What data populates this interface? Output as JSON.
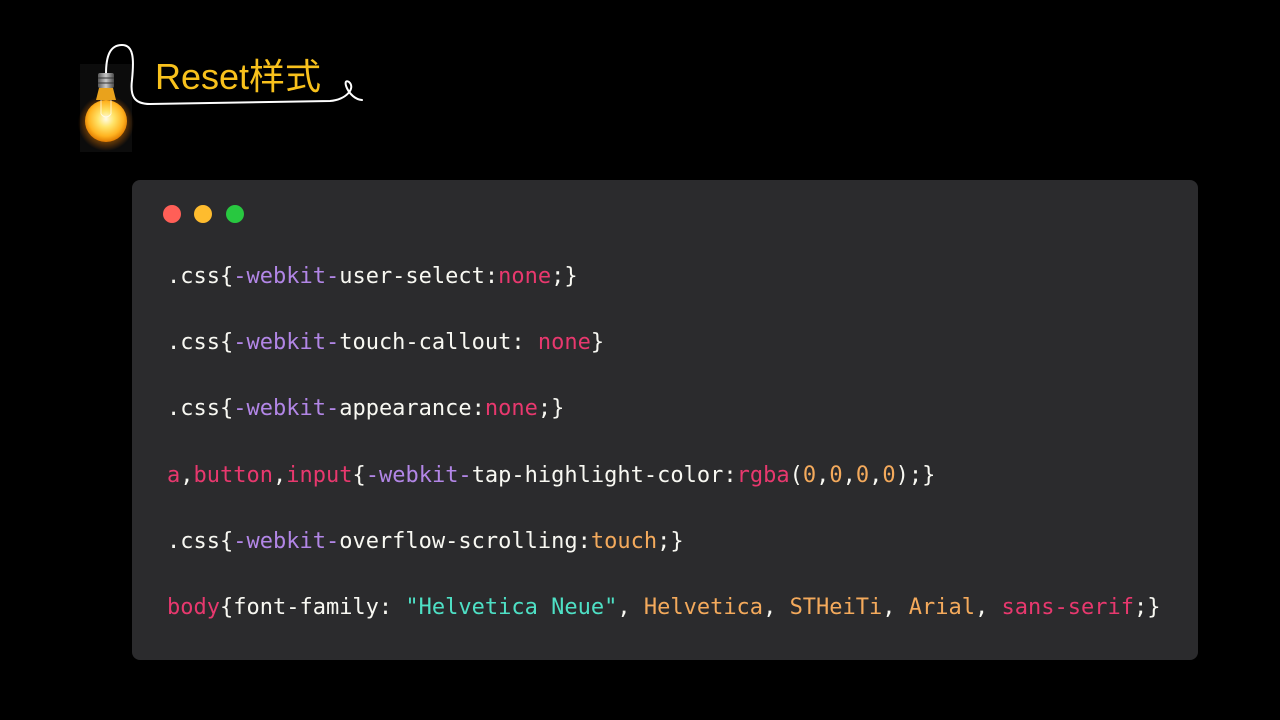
{
  "slide": {
    "title": "Reset样式",
    "title_color": "#f8c11c",
    "background": "#000000",
    "icon": "lightbulb-icon"
  },
  "code_window": {
    "background": "#2b2b2d",
    "window_controls": [
      "#ff5f57",
      "#febc2e",
      "#28c840"
    ],
    "lines": [
      {
        "tokens": [
          {
            "text": ".css{",
            "color": "#f8f8f2"
          },
          {
            "text": "-webkit-",
            "color": "#b286e6"
          },
          {
            "text": "user-select:",
            "color": "#f8f8f2"
          },
          {
            "text": "none",
            "color": "#e8386e"
          },
          {
            "text": ";}",
            "color": "#f8f8f2"
          }
        ]
      },
      {
        "tokens": [
          {
            "text": ".css{",
            "color": "#f8f8f2"
          },
          {
            "text": "-webkit-",
            "color": "#b286e6"
          },
          {
            "text": "touch-callout: ",
            "color": "#f8f8f2"
          },
          {
            "text": "none",
            "color": "#e8386e"
          },
          {
            "text": "}",
            "color": "#f8f8f2"
          }
        ]
      },
      {
        "tokens": [
          {
            "text": ".css{",
            "color": "#f8f8f2"
          },
          {
            "text": "-webkit-",
            "color": "#b286e6"
          },
          {
            "text": "appearance:",
            "color": "#f8f8f2"
          },
          {
            "text": "none",
            "color": "#e8386e"
          },
          {
            "text": ";}",
            "color": "#f8f8f2"
          }
        ]
      },
      {
        "tokens": [
          {
            "text": "a",
            "color": "#e8386e"
          },
          {
            "text": ",",
            "color": "#f8f8f2"
          },
          {
            "text": "button",
            "color": "#e8386e"
          },
          {
            "text": ",",
            "color": "#f8f8f2"
          },
          {
            "text": "input",
            "color": "#e8386e"
          },
          {
            "text": "{",
            "color": "#f8f8f2"
          },
          {
            "text": "-webkit-",
            "color": "#b286e6"
          },
          {
            "text": "tap-highlight-color:",
            "color": "#f8f8f2"
          },
          {
            "text": "rgba",
            "color": "#e8386e"
          },
          {
            "text": "(",
            "color": "#f8f8f2"
          },
          {
            "text": "0",
            "color": "#f4aa5c"
          },
          {
            "text": ",",
            "color": "#f8f8f2"
          },
          {
            "text": "0",
            "color": "#f4aa5c"
          },
          {
            "text": ",",
            "color": "#f8f8f2"
          },
          {
            "text": "0",
            "color": "#f4aa5c"
          },
          {
            "text": ",",
            "color": "#f8f8f2"
          },
          {
            "text": "0",
            "color": "#f4aa5c"
          },
          {
            "text": ");}",
            "color": "#f8f8f2"
          }
        ]
      },
      {
        "tokens": [
          {
            "text": ".css{",
            "color": "#f8f8f2"
          },
          {
            "text": "-webkit-",
            "color": "#b286e6"
          },
          {
            "text": "overflow-scrolling:",
            "color": "#f8f8f2"
          },
          {
            "text": "touch",
            "color": "#f4aa5c"
          },
          {
            "text": ";}",
            "color": "#f8f8f2"
          }
        ]
      },
      {
        "tokens": [
          {
            "text": "body",
            "color": "#e8386e"
          },
          {
            "text": "{font-family: ",
            "color": "#f8f8f2"
          },
          {
            "text": "\"Helvetica Neue\"",
            "color": "#4ee0c5"
          },
          {
            "text": ", ",
            "color": "#f8f8f2"
          },
          {
            "text": "Helvetica",
            "color": "#f4aa5c"
          },
          {
            "text": ", ",
            "color": "#f8f8f2"
          },
          {
            "text": "STHeiTi",
            "color": "#f4aa5c"
          },
          {
            "text": ", ",
            "color": "#f8f8f2"
          },
          {
            "text": "Arial",
            "color": "#f4aa5c"
          },
          {
            "text": ", ",
            "color": "#f8f8f2"
          },
          {
            "text": "sans-serif",
            "color": "#e8386e"
          },
          {
            "text": ";}",
            "color": "#f8f8f2"
          }
        ]
      }
    ]
  }
}
